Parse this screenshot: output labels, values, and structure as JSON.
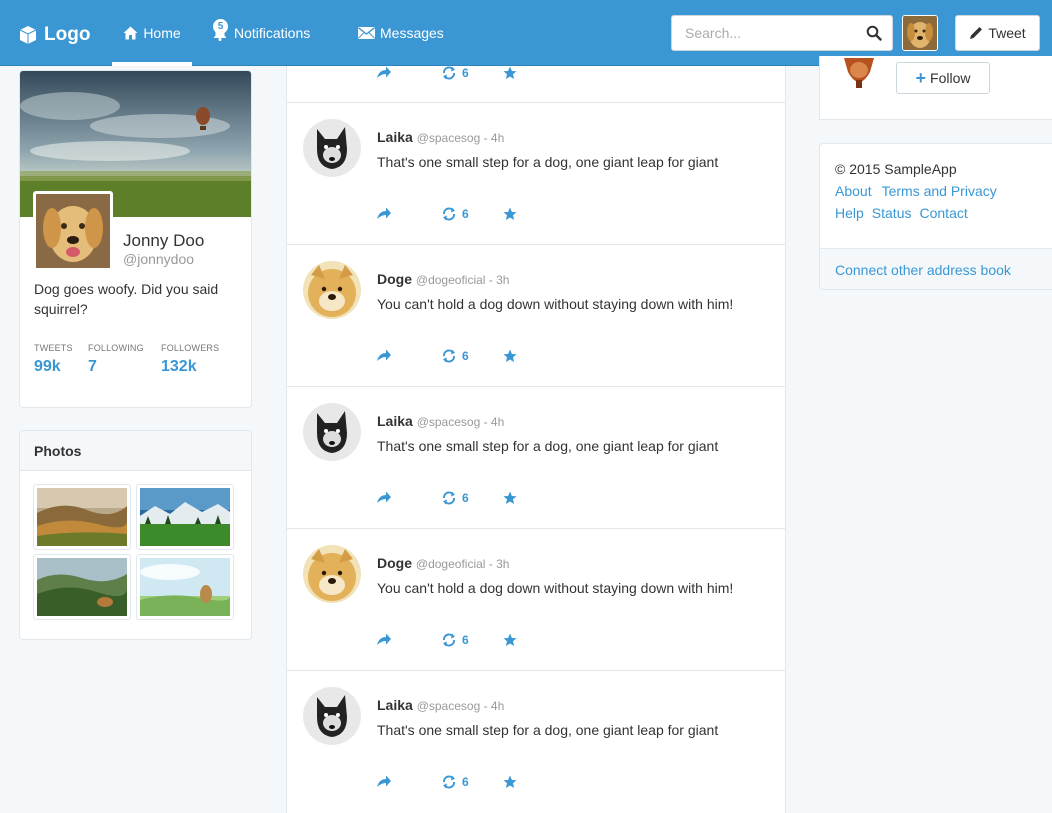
{
  "navbar": {
    "brand": "Logo",
    "home": "Home",
    "notifications": "Notifications",
    "notif_count": "5",
    "messages": "Messages",
    "search_placeholder": "Search...",
    "tweet_button": "Tweet"
  },
  "profile": {
    "name": "Jonny Doo",
    "handle": "@jonnydoo",
    "bio": "Dog goes woofy. Did you said squirrel?",
    "stats": [
      {
        "label": "TWEETS",
        "value": "99k"
      },
      {
        "label": "FOLLOWING",
        "value": "7"
      },
      {
        "label": "FOLLOWERS",
        "value": "132k"
      }
    ]
  },
  "photos": {
    "title": "Photos"
  },
  "feed": {
    "top_retweet_count": "6",
    "tweets": [
      {
        "name": "Laika",
        "meta": "@spacesog - 4h",
        "text": "That's one small step for a dog, one giant leap for giant",
        "retweets": "6"
      },
      {
        "name": "Doge",
        "meta": "@dogeoficial - 3h",
        "text": "You can't hold a dog down without staying down with him!",
        "retweets": "6"
      },
      {
        "name": "Laika",
        "meta": "@spacesog - 4h",
        "text": "That's one small step for a dog, one giant leap for giant",
        "retweets": "6"
      },
      {
        "name": "Doge",
        "meta": "@dogeoficial - 3h",
        "text": "You can't hold a dog down without staying down with him!",
        "retweets": "6"
      },
      {
        "name": "Laika",
        "meta": "@spacesog - 4h",
        "text": "That's one small step for a dog, one giant leap for giant",
        "retweets": "6"
      }
    ]
  },
  "sidebar": {
    "follow_label": "Follow",
    "copyright": "© 2015 SampleApp",
    "links_row1": [
      "About",
      "Terms and Privacy"
    ],
    "links_row2": [
      "Help",
      "Status",
      "Contact"
    ],
    "connect": "Connect other address book"
  },
  "colors": {
    "accent": "#3a97d4",
    "background": "#f5f8fa"
  }
}
